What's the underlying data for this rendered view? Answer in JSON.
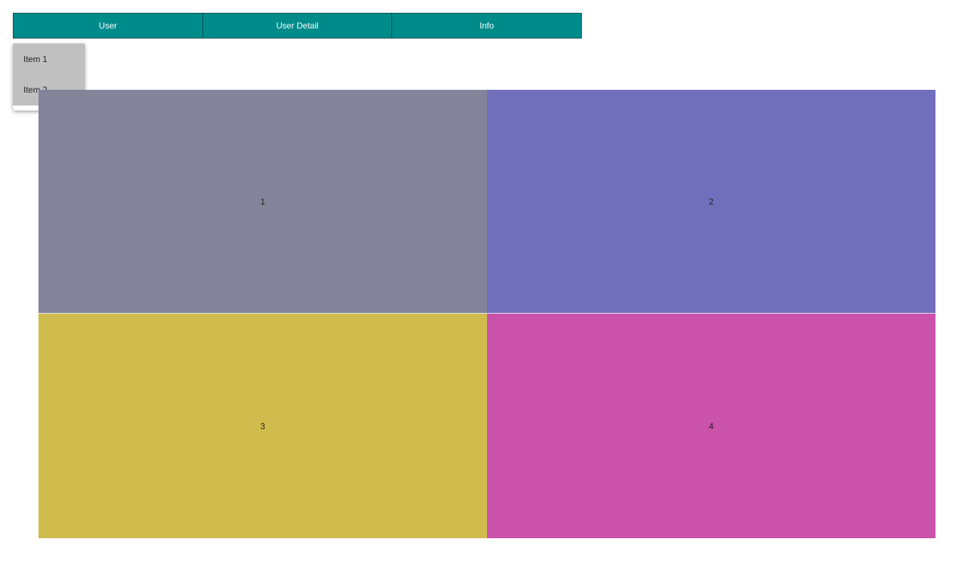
{
  "navbar": {
    "buttons": [
      {
        "label": "User"
      },
      {
        "label": "User Detail"
      },
      {
        "label": "Info"
      }
    ]
  },
  "dropdown": {
    "items": [
      {
        "label": "Item 1"
      },
      {
        "label": "Item 2"
      }
    ]
  },
  "grid": {
    "cells": [
      {
        "label": "1",
        "color": "#83839a"
      },
      {
        "label": "2",
        "color": "#716fbb"
      },
      {
        "label": "3",
        "color": "#d0bb4d"
      },
      {
        "label": "4",
        "color": "#ca52a8"
      }
    ]
  },
  "colors": {
    "nav_background": "#008b8b",
    "dropdown_background": "#c0c0c0"
  }
}
